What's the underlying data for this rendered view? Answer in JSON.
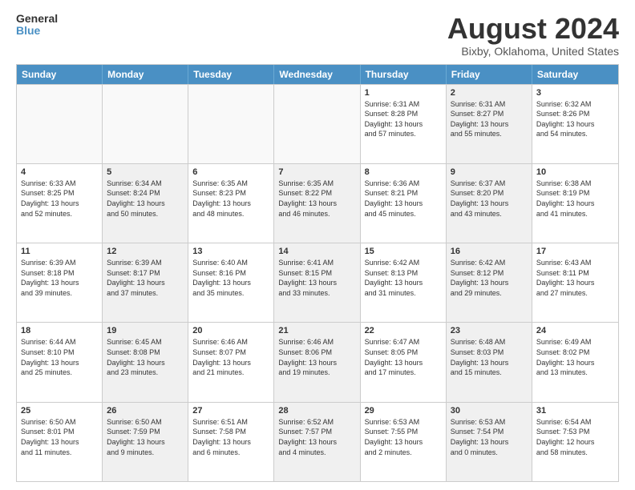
{
  "header": {
    "logo_line1": "General",
    "logo_line2": "Blue",
    "title": "August 2024",
    "subtitle": "Bixby, Oklahoma, United States"
  },
  "weekdays": [
    "Sunday",
    "Monday",
    "Tuesday",
    "Wednesday",
    "Thursday",
    "Friday",
    "Saturday"
  ],
  "weeks": [
    [
      {
        "day": "",
        "info": "",
        "shaded": false,
        "empty": true
      },
      {
        "day": "",
        "info": "",
        "shaded": false,
        "empty": true
      },
      {
        "day": "",
        "info": "",
        "shaded": false,
        "empty": true
      },
      {
        "day": "",
        "info": "",
        "shaded": false,
        "empty": true
      },
      {
        "day": "1",
        "info": "Sunrise: 6:31 AM\nSunset: 8:28 PM\nDaylight: 13 hours\nand 57 minutes.",
        "shaded": false,
        "empty": false
      },
      {
        "day": "2",
        "info": "Sunrise: 6:31 AM\nSunset: 8:27 PM\nDaylight: 13 hours\nand 55 minutes.",
        "shaded": true,
        "empty": false
      },
      {
        "day": "3",
        "info": "Sunrise: 6:32 AM\nSunset: 8:26 PM\nDaylight: 13 hours\nand 54 minutes.",
        "shaded": false,
        "empty": false
      }
    ],
    [
      {
        "day": "4",
        "info": "Sunrise: 6:33 AM\nSunset: 8:25 PM\nDaylight: 13 hours\nand 52 minutes.",
        "shaded": false,
        "empty": false
      },
      {
        "day": "5",
        "info": "Sunrise: 6:34 AM\nSunset: 8:24 PM\nDaylight: 13 hours\nand 50 minutes.",
        "shaded": true,
        "empty": false
      },
      {
        "day": "6",
        "info": "Sunrise: 6:35 AM\nSunset: 8:23 PM\nDaylight: 13 hours\nand 48 minutes.",
        "shaded": false,
        "empty": false
      },
      {
        "day": "7",
        "info": "Sunrise: 6:35 AM\nSunset: 8:22 PM\nDaylight: 13 hours\nand 46 minutes.",
        "shaded": true,
        "empty": false
      },
      {
        "day": "8",
        "info": "Sunrise: 6:36 AM\nSunset: 8:21 PM\nDaylight: 13 hours\nand 45 minutes.",
        "shaded": false,
        "empty": false
      },
      {
        "day": "9",
        "info": "Sunrise: 6:37 AM\nSunset: 8:20 PM\nDaylight: 13 hours\nand 43 minutes.",
        "shaded": true,
        "empty": false
      },
      {
        "day": "10",
        "info": "Sunrise: 6:38 AM\nSunset: 8:19 PM\nDaylight: 13 hours\nand 41 minutes.",
        "shaded": false,
        "empty": false
      }
    ],
    [
      {
        "day": "11",
        "info": "Sunrise: 6:39 AM\nSunset: 8:18 PM\nDaylight: 13 hours\nand 39 minutes.",
        "shaded": false,
        "empty": false
      },
      {
        "day": "12",
        "info": "Sunrise: 6:39 AM\nSunset: 8:17 PM\nDaylight: 13 hours\nand 37 minutes.",
        "shaded": true,
        "empty": false
      },
      {
        "day": "13",
        "info": "Sunrise: 6:40 AM\nSunset: 8:16 PM\nDaylight: 13 hours\nand 35 minutes.",
        "shaded": false,
        "empty": false
      },
      {
        "day": "14",
        "info": "Sunrise: 6:41 AM\nSunset: 8:15 PM\nDaylight: 13 hours\nand 33 minutes.",
        "shaded": true,
        "empty": false
      },
      {
        "day": "15",
        "info": "Sunrise: 6:42 AM\nSunset: 8:13 PM\nDaylight: 13 hours\nand 31 minutes.",
        "shaded": false,
        "empty": false
      },
      {
        "day": "16",
        "info": "Sunrise: 6:42 AM\nSunset: 8:12 PM\nDaylight: 13 hours\nand 29 minutes.",
        "shaded": true,
        "empty": false
      },
      {
        "day": "17",
        "info": "Sunrise: 6:43 AM\nSunset: 8:11 PM\nDaylight: 13 hours\nand 27 minutes.",
        "shaded": false,
        "empty": false
      }
    ],
    [
      {
        "day": "18",
        "info": "Sunrise: 6:44 AM\nSunset: 8:10 PM\nDaylight: 13 hours\nand 25 minutes.",
        "shaded": false,
        "empty": false
      },
      {
        "day": "19",
        "info": "Sunrise: 6:45 AM\nSunset: 8:08 PM\nDaylight: 13 hours\nand 23 minutes.",
        "shaded": true,
        "empty": false
      },
      {
        "day": "20",
        "info": "Sunrise: 6:46 AM\nSunset: 8:07 PM\nDaylight: 13 hours\nand 21 minutes.",
        "shaded": false,
        "empty": false
      },
      {
        "day": "21",
        "info": "Sunrise: 6:46 AM\nSunset: 8:06 PM\nDaylight: 13 hours\nand 19 minutes.",
        "shaded": true,
        "empty": false
      },
      {
        "day": "22",
        "info": "Sunrise: 6:47 AM\nSunset: 8:05 PM\nDaylight: 13 hours\nand 17 minutes.",
        "shaded": false,
        "empty": false
      },
      {
        "day": "23",
        "info": "Sunrise: 6:48 AM\nSunset: 8:03 PM\nDaylight: 13 hours\nand 15 minutes.",
        "shaded": true,
        "empty": false
      },
      {
        "day": "24",
        "info": "Sunrise: 6:49 AM\nSunset: 8:02 PM\nDaylight: 13 hours\nand 13 minutes.",
        "shaded": false,
        "empty": false
      }
    ],
    [
      {
        "day": "25",
        "info": "Sunrise: 6:50 AM\nSunset: 8:01 PM\nDaylight: 13 hours\nand 11 minutes.",
        "shaded": false,
        "empty": false
      },
      {
        "day": "26",
        "info": "Sunrise: 6:50 AM\nSunset: 7:59 PM\nDaylight: 13 hours\nand 9 minutes.",
        "shaded": true,
        "empty": false
      },
      {
        "day": "27",
        "info": "Sunrise: 6:51 AM\nSunset: 7:58 PM\nDaylight: 13 hours\nand 6 minutes.",
        "shaded": false,
        "empty": false
      },
      {
        "day": "28",
        "info": "Sunrise: 6:52 AM\nSunset: 7:57 PM\nDaylight: 13 hours\nand 4 minutes.",
        "shaded": true,
        "empty": false
      },
      {
        "day": "29",
        "info": "Sunrise: 6:53 AM\nSunset: 7:55 PM\nDaylight: 13 hours\nand 2 minutes.",
        "shaded": false,
        "empty": false
      },
      {
        "day": "30",
        "info": "Sunrise: 6:53 AM\nSunset: 7:54 PM\nDaylight: 13 hours\nand 0 minutes.",
        "shaded": true,
        "empty": false
      },
      {
        "day": "31",
        "info": "Sunrise: 6:54 AM\nSunset: 7:53 PM\nDaylight: 12 hours\nand 58 minutes.",
        "shaded": false,
        "empty": false
      }
    ]
  ]
}
